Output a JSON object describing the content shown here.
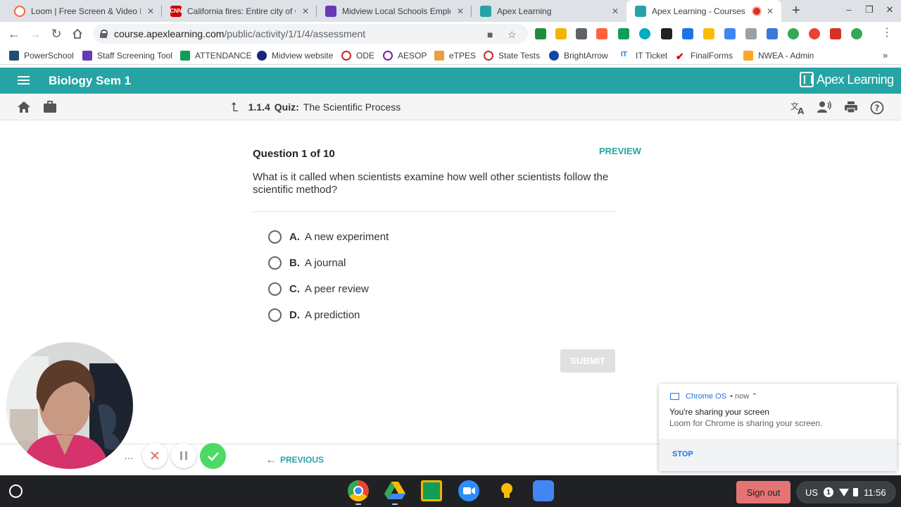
{
  "browser": {
    "tabs": [
      {
        "title": "Loom | Free Screen & Video Rec",
        "favicon_color": "#ff623e",
        "favicon": "loom-icon"
      },
      {
        "title": "California fires: Entire city of Ca",
        "favicon_color": "#cc0000",
        "favicon_text": "CNN",
        "favicon": "cnn-icon"
      },
      {
        "title": "Midview Local Schools Employe",
        "favicon_color": "#673ab7",
        "favicon": "forms-icon"
      },
      {
        "title": "Apex Learning",
        "favicon_color": "#26a4a5",
        "favicon": "apex-icon"
      },
      {
        "title": "Apex Learning - Courses",
        "favicon_color": "#26a4a5",
        "favicon": "apex-icon",
        "active": true
      }
    ],
    "url_host": "course.apexlearning.com",
    "url_path": "/public/activity/1/1/4/assessment",
    "bookmarks": [
      {
        "label": "PowerSchool",
        "color": "#1f4e79"
      },
      {
        "label": "Staff Screening Tool",
        "color": "#673ab7"
      },
      {
        "label": "ATTENDANCE",
        "color": "#0f9d58"
      },
      {
        "label": "Midview website",
        "color": "#1a237e"
      },
      {
        "label": "ODE",
        "color": "#c62828"
      },
      {
        "label": "AESOP",
        "color": "#7b1fa2"
      },
      {
        "label": "eTPES",
        "color": "#e6a23c"
      },
      {
        "label": "State Tests",
        "color": "#c62828"
      },
      {
        "label": "BrightArrow",
        "color": "#0d47a1"
      },
      {
        "label": "IT Ticket",
        "color": "#1a73e8"
      },
      {
        "label": "FinalForms",
        "color": "#d50000"
      },
      {
        "label": "NWEA - Admin",
        "color": "#f9a825"
      }
    ],
    "bookmarks_overflow": "»"
  },
  "apex": {
    "course_title": "Biology Sem 1",
    "logo_text": "Apex Learning",
    "brand_color": "#26a4a5",
    "breadcrumb_number": "1.1.4",
    "breadcrumb_type": "Quiz:",
    "breadcrumb_title": "The Scientific Process"
  },
  "quiz": {
    "heading": "Question 1 of 10",
    "preview": "PREVIEW",
    "question": "What is it called when scientists examine how well other scientists follow the scientific method?",
    "options": [
      {
        "letter": "A.",
        "text": "A new experiment"
      },
      {
        "letter": "B.",
        "text": "A journal"
      },
      {
        "letter": "C.",
        "text": "A peer review"
      },
      {
        "letter": "D.",
        "text": "A prediction"
      }
    ],
    "submit": "SUBMIT",
    "previous": "PREVIOUS"
  },
  "loom": {
    "more_icon": "…"
  },
  "notification": {
    "source": "Chrome OS",
    "time": "• now ⌃",
    "title": "You're sharing your screen",
    "body": "Loom for Chrome is sharing your screen.",
    "action": "STOP"
  },
  "shelf": {
    "signout": "Sign out",
    "locale": "US",
    "notif_count": "1",
    "time": "11:56"
  }
}
